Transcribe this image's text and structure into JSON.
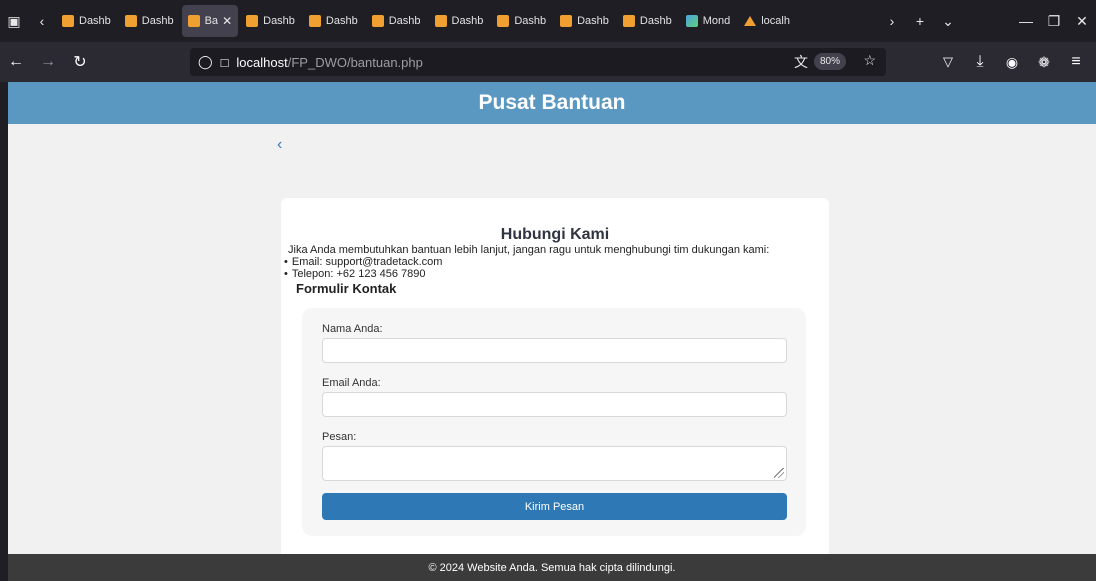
{
  "browser": {
    "tabs": [
      {
        "label": "Dashb",
        "icon": "xampp-favicon"
      },
      {
        "label": "Dashb",
        "icon": "xampp-favicon"
      },
      {
        "label": "Ba",
        "icon": "xampp-favicon",
        "active": true
      },
      {
        "label": "Dashb",
        "icon": "xampp-favicon"
      },
      {
        "label": "Dashb",
        "icon": "xampp-favicon"
      },
      {
        "label": "Dashb",
        "icon": "xampp-favicon"
      },
      {
        "label": "Dashb",
        "icon": "xampp-favicon"
      },
      {
        "label": "Dashb",
        "icon": "xampp-favicon"
      },
      {
        "label": "Dashb",
        "icon": "xampp-favicon"
      },
      {
        "label": "Dashb",
        "icon": "xampp-favicon"
      },
      {
        "label": "Mond",
        "icon": "monitor-favicon"
      },
      {
        "label": "localh",
        "icon": "xampp-logo-favicon"
      }
    ],
    "url_host": "localhost",
    "url_path": "/FP_DWO/bantuan.php",
    "zoom": "80%"
  },
  "page": {
    "header_title": "Pusat Bantuan",
    "back_glyph": "‹",
    "card": {
      "title": "Hubungi Kami",
      "intro": "Jika Anda membutuhkan bantuan lebih lanjut, jangan ragu untuk menghubungi tim dukungan kami:",
      "contacts": [
        "Email: support@tradetack.com",
        "Telepon: +62 123 456 7890"
      ],
      "form_title": "Formulir Kontak",
      "form": {
        "name_label": "Nama Anda:",
        "email_label": "Email Anda:",
        "message_label": "Pesan:",
        "submit_label": "Kirim Pesan"
      }
    },
    "footer": "© 2024 Website Anda. Semua hak cipta dilindungi."
  },
  "colors": {
    "header_bg": "#5a97c1",
    "button_bg": "#2e79b5",
    "footer_bg": "#3b3b3b",
    "page_bg": "#f1f1f1"
  }
}
